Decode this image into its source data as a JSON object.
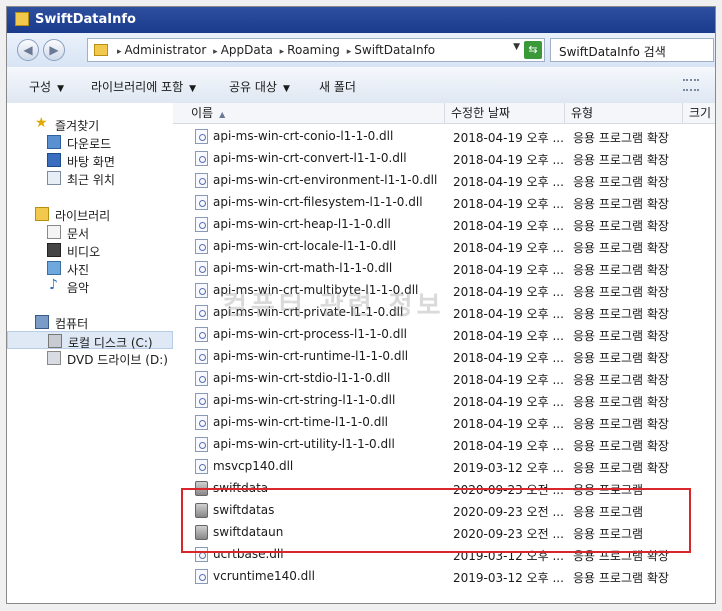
{
  "window": {
    "title": "SwiftDataInfo"
  },
  "address": {
    "crumbs": [
      "Administrator",
      "AppData",
      "Roaming",
      "SwiftDataInfo"
    ],
    "search_placeholder": "SwiftDataInfo 검색"
  },
  "toolbar": {
    "organize": "구성",
    "include_library": "라이브러리에 포함",
    "share": "공유 대상",
    "new_folder": "새 폴더"
  },
  "nav": {
    "favorites": {
      "label": "즐겨찾기",
      "items": [
        "다운로드",
        "바탕 화면",
        "최근 위치"
      ]
    },
    "libraries": {
      "label": "라이브러리",
      "items": [
        "문서",
        "비디오",
        "사진",
        "음악"
      ]
    },
    "computer": {
      "label": "컴퓨터",
      "items": [
        "로컬 디스크 (C:)",
        "DVD 드라이브 (D:)"
      ]
    }
  },
  "columns": {
    "name": "이름",
    "date": "수정한 날짜",
    "type": "유형",
    "size": "크기"
  },
  "files": [
    {
      "name": "api-ms-win-crt-conio-l1-1-0.dll",
      "date": "2018-04-19 오후 ...",
      "type": "응용 프로그램 확장",
      "kind": "dll"
    },
    {
      "name": "api-ms-win-crt-convert-l1-1-0.dll",
      "date": "2018-04-19 오후 ...",
      "type": "응용 프로그램 확장",
      "kind": "dll"
    },
    {
      "name": "api-ms-win-crt-environment-l1-1-0.dll",
      "date": "2018-04-19 오후 ...",
      "type": "응용 프로그램 확장",
      "kind": "dll"
    },
    {
      "name": "api-ms-win-crt-filesystem-l1-1-0.dll",
      "date": "2018-04-19 오후 ...",
      "type": "응용 프로그램 확장",
      "kind": "dll"
    },
    {
      "name": "api-ms-win-crt-heap-l1-1-0.dll",
      "date": "2018-04-19 오후 ...",
      "type": "응용 프로그램 확장",
      "kind": "dll"
    },
    {
      "name": "api-ms-win-crt-locale-l1-1-0.dll",
      "date": "2018-04-19 오후 ...",
      "type": "응용 프로그램 확장",
      "kind": "dll"
    },
    {
      "name": "api-ms-win-crt-math-l1-1-0.dll",
      "date": "2018-04-19 오후 ...",
      "type": "응용 프로그램 확장",
      "kind": "dll"
    },
    {
      "name": "api-ms-win-crt-multibyte-l1-1-0.dll",
      "date": "2018-04-19 오후 ...",
      "type": "응용 프로그램 확장",
      "kind": "dll"
    },
    {
      "name": "api-ms-win-crt-private-l1-1-0.dll",
      "date": "2018-04-19 오후 ...",
      "type": "응용 프로그램 확장",
      "kind": "dll"
    },
    {
      "name": "api-ms-win-crt-process-l1-1-0.dll",
      "date": "2018-04-19 오후 ...",
      "type": "응용 프로그램 확장",
      "kind": "dll"
    },
    {
      "name": "api-ms-win-crt-runtime-l1-1-0.dll",
      "date": "2018-04-19 오후 ...",
      "type": "응용 프로그램 확장",
      "kind": "dll"
    },
    {
      "name": "api-ms-win-crt-stdio-l1-1-0.dll",
      "date": "2018-04-19 오후 ...",
      "type": "응용 프로그램 확장",
      "kind": "dll"
    },
    {
      "name": "api-ms-win-crt-string-l1-1-0.dll",
      "date": "2018-04-19 오후 ...",
      "type": "응용 프로그램 확장",
      "kind": "dll"
    },
    {
      "name": "api-ms-win-crt-time-l1-1-0.dll",
      "date": "2018-04-19 오후 ...",
      "type": "응용 프로그램 확장",
      "kind": "dll"
    },
    {
      "name": "api-ms-win-crt-utility-l1-1-0.dll",
      "date": "2018-04-19 오후 ...",
      "type": "응용 프로그램 확장",
      "kind": "dll"
    },
    {
      "name": "msvcp140.dll",
      "date": "2019-03-12 오후 ...",
      "type": "응용 프로그램 확장",
      "kind": "dll"
    },
    {
      "name": "swiftdata",
      "date": "2020-09-23 오전 ...",
      "type": "응용 프로그램",
      "kind": "exe"
    },
    {
      "name": "swiftdatas",
      "date": "2020-09-23 오전 ...",
      "type": "응용 프로그램",
      "kind": "exe"
    },
    {
      "name": "swiftdataun",
      "date": "2020-09-23 오전 ...",
      "type": "응용 프로그램",
      "kind": "exe"
    },
    {
      "name": "ucrtbase.dll",
      "date": "2019-03-12 오후 ...",
      "type": "응용 프로그램 확장",
      "kind": "dll"
    },
    {
      "name": "vcruntime140.dll",
      "date": "2019-03-12 오후 ...",
      "type": "응용 프로그램 확장",
      "kind": "dll"
    }
  ],
  "watermark": "컴퓨터 관련 정보",
  "colors": {
    "highlight": "#d9262b",
    "titlebar": "#1a3a8c"
  }
}
